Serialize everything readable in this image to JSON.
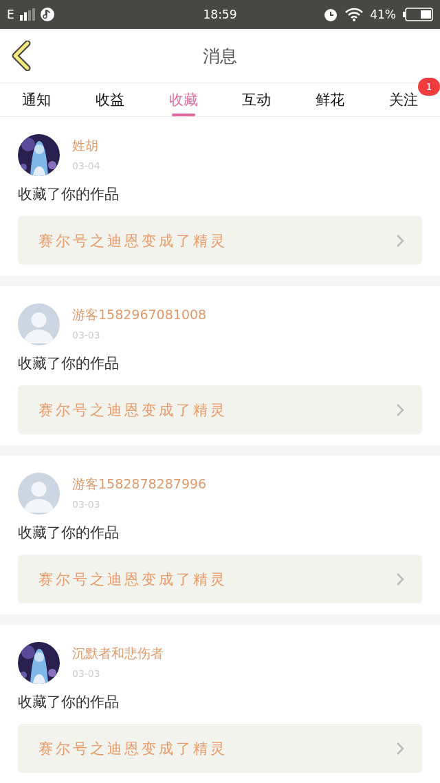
{
  "status_bar": {
    "network": "E",
    "time": "18:59",
    "battery": "41%"
  },
  "header": {
    "title": "消息"
  },
  "tabs": [
    {
      "label": "通知",
      "selected": false
    },
    {
      "label": "收益",
      "selected": false
    },
    {
      "label": "收藏",
      "selected": true
    },
    {
      "label": "互动",
      "selected": false
    },
    {
      "label": "鲜花",
      "selected": false
    },
    {
      "label": "关注",
      "selected": false,
      "badge": "1"
    }
  ],
  "messages": [
    {
      "name": "姓胡",
      "date": "03-04",
      "action": "收藏了你的作品",
      "work": "赛尔号之迪恩变成了精灵"
    },
    {
      "avatar": {
        "kind": "default"
      },
      "name": "游客1582967081008",
      "date": "03-03",
      "action": "收藏了你的作品",
      "work": "赛尔号之迪恩变成了精灵"
    },
    {
      "avatar": {
        "kind": "default"
      },
      "name": "游客1582878287996",
      "date": "03-03",
      "action": "收藏了你的作品",
      "work": "赛尔号之迪恩变成了精灵"
    },
    {
      "name": "沉默者和悲伤者",
      "date": "03-03",
      "action": "收藏了你的作品",
      "work": "赛尔号之迪恩变成了精灵"
    }
  ]
}
